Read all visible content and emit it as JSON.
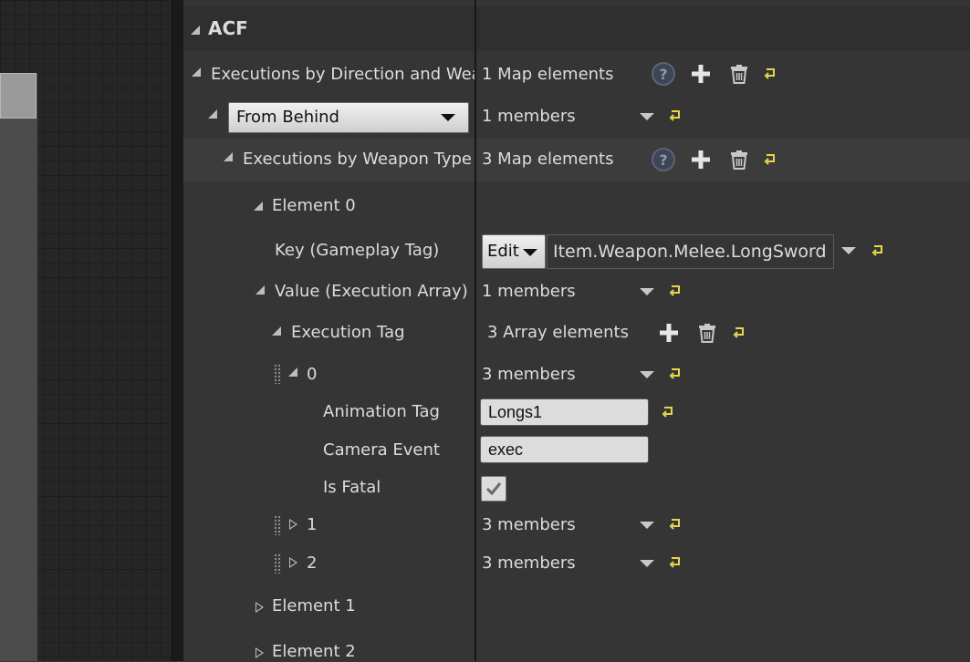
{
  "category": "ACF",
  "rows": {
    "executions_direction": {
      "label": "Executions by Direction and Weap",
      "value": "1 Map elements"
    },
    "direction_select": {
      "selected": "From Behind",
      "value": "1 members"
    },
    "executions_weapon": {
      "label": "Executions by Weapon Type",
      "value": "3 Map elements"
    },
    "element0": {
      "label": "Element 0"
    },
    "key": {
      "label": "Key (Gameplay Tag)",
      "edit_label": "Edit",
      "tag_value": "Item.Weapon.Melee.LongSword"
    },
    "value_exec": {
      "label": "Value (Execution Array)",
      "value": "1 members"
    },
    "exec_tag": {
      "label": "Execution Tag",
      "value": "3 Array elements"
    },
    "idx0": {
      "label": "0",
      "value": "3 members"
    },
    "anim_tag": {
      "label": "Animation Tag",
      "value": "Longs1"
    },
    "camera_event": {
      "label": "Camera Event",
      "value": "exec"
    },
    "is_fatal": {
      "label": "Is Fatal",
      "checked": true
    },
    "idx1": {
      "label": "1",
      "value": "3 members"
    },
    "idx2": {
      "label": "2",
      "value": "3 members"
    },
    "element1": {
      "label": "Element 1"
    },
    "element2": {
      "label": "Element 2"
    }
  },
  "colors": {
    "reset_arrow": "#e6d84a",
    "panel_bg": "#353535",
    "highlight_row": "#3c3c3c"
  }
}
